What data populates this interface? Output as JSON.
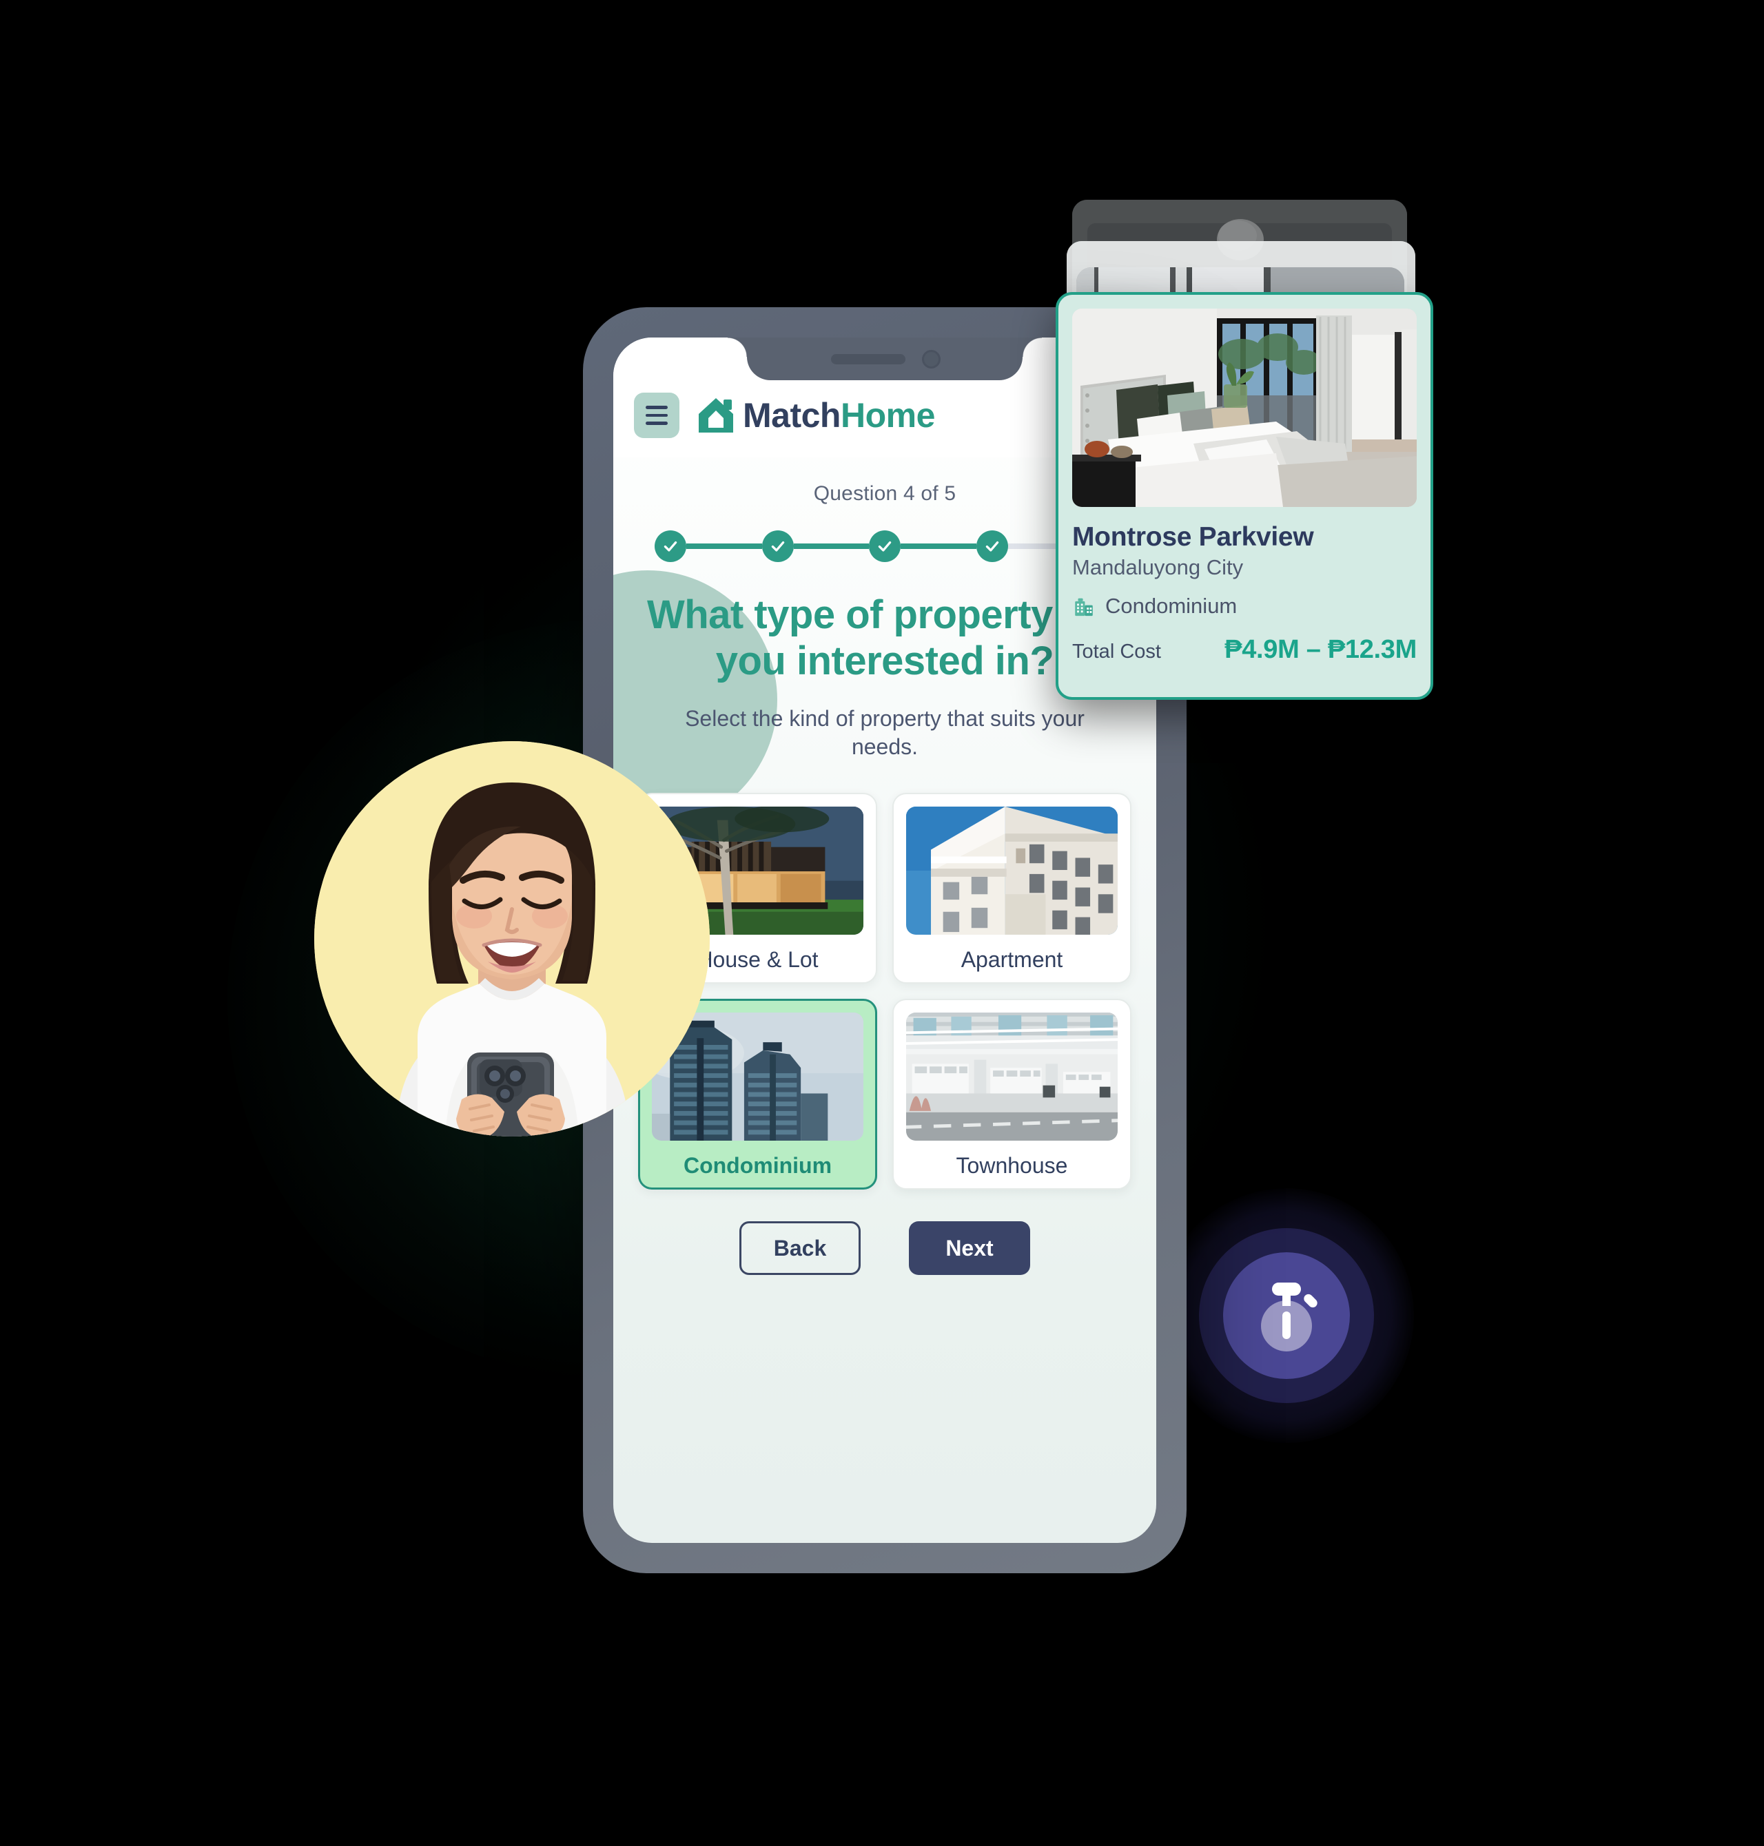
{
  "app": {
    "brand_match": "Match",
    "brand_home": "Home",
    "logo_icon": "house-icon",
    "menu_icon": "hamburger-menu-icon"
  },
  "question": {
    "counter": "Question 4 of 5",
    "title_line1": "What type of property are",
    "title_line2": "you interested in?",
    "subtitle": "Select the kind of property that suits your needs.",
    "progress": {
      "total_steps": 5,
      "completed_steps": 4,
      "step_icon": "check-icon"
    },
    "options": [
      {
        "label": "House & Lot",
        "image": "modern-house-exterior-photo",
        "selected": false
      },
      {
        "label": "Apartment",
        "image": "apartment-building-photo",
        "selected": false
      },
      {
        "label": "Condominium",
        "image": "condo-towers-photo",
        "selected": true
      },
      {
        "label": "Townhouse",
        "image": "townhouse-row-photo",
        "selected": false
      }
    ],
    "nav": {
      "back_label": "Back",
      "next_label": "Next"
    }
  },
  "property_card": {
    "image": "bedroom-interior-photo",
    "title": "Montrose Parkview",
    "city": "Mandaluyong City",
    "type_icon": "building-icon",
    "type_label": "Condominium",
    "cost_label": "Total Cost",
    "cost_value": "₱4.9M – ₱12.3M"
  },
  "stopwatch_badge": {
    "icon": "stopwatch-icon"
  },
  "avatar": {
    "image": "smiling-woman-holding-phone-photo"
  },
  "colors": {
    "teal_accent": "#2b9b85",
    "teal_border": "#22a088",
    "navy_text": "#32405f",
    "mint_screen": "#e8f0ee",
    "selected_green": "#b8edc4",
    "card_mint": "#d4ebe4",
    "avatar_yellow": "#f9edae",
    "badge_purple": "#4a4794",
    "page_background": "#000000"
  }
}
